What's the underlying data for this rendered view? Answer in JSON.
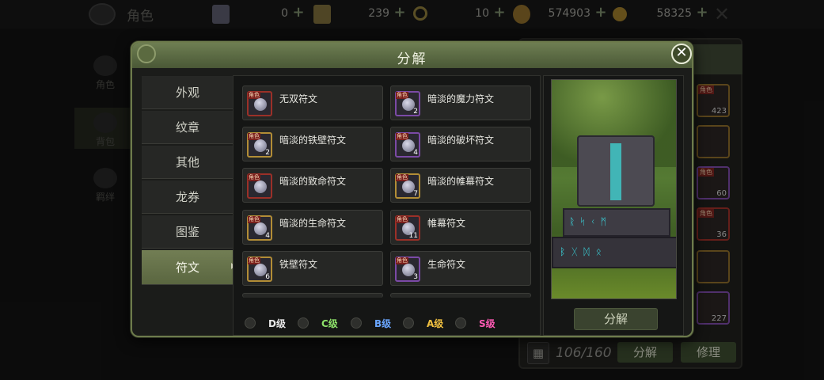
{
  "topbar": {
    "title": "角色",
    "currencies": [
      {
        "icon": "ticket-icon",
        "value": "0"
      },
      {
        "icon": "card-icon",
        "value": "239"
      },
      {
        "icon": "ring-icon",
        "value": "10"
      },
      {
        "icon": "gold-pouch-icon",
        "value": "574903"
      },
      {
        "icon": "coin-icon",
        "value": "58325"
      }
    ],
    "plus": "+",
    "close": "✕"
  },
  "bg_nav": [
    "角色",
    "背包",
    "羁绊"
  ],
  "inventory": {
    "slot_tag": "角色",
    "counts": [
      "423",
      "",
      "60",
      "36",
      "",
      "227"
    ],
    "capacity": "106/160",
    "grid_icon": "▦",
    "decompose_label": "分解",
    "repair_label": "修理"
  },
  "modal": {
    "title": "分解",
    "close": "✕",
    "tabs": [
      "外观",
      "纹章",
      "其他",
      "龙券",
      "图鉴",
      "符文"
    ],
    "active_tab": "符文",
    "items": [
      {
        "name": "无双符文",
        "tag": "角色",
        "count": ""
      },
      {
        "name": "暗淡的魔力符文",
        "tag": "角色",
        "count": "2"
      },
      {
        "name": "暗淡的铁壁符文",
        "tag": "角色",
        "count": "2"
      },
      {
        "name": "暗淡的破坏符文",
        "tag": "角色",
        "count": "4"
      },
      {
        "name": "暗淡的致命符文",
        "tag": "角色",
        "count": ""
      },
      {
        "name": "暗淡的帷幕符文",
        "tag": "角色",
        "count": "7"
      },
      {
        "name": "暗淡的生命符文",
        "tag": "角色",
        "count": "4"
      },
      {
        "name": "帷幕符文",
        "tag": "角色",
        "count": "11"
      },
      {
        "name": "铁壁符文",
        "tag": "角色",
        "count": "6"
      },
      {
        "name": "生命符文",
        "tag": "角色",
        "count": "3"
      }
    ],
    "grades": [
      {
        "label": "D级",
        "color": "#e8e8e8"
      },
      {
        "label": "C级",
        "color": "#8ee26a"
      },
      {
        "label": "B级",
        "color": "#6aa6ff"
      },
      {
        "label": "A级",
        "color": "#f0c040"
      },
      {
        "label": "S级",
        "color": "#ff5ab4"
      }
    ],
    "decompose_button": "分解"
  }
}
